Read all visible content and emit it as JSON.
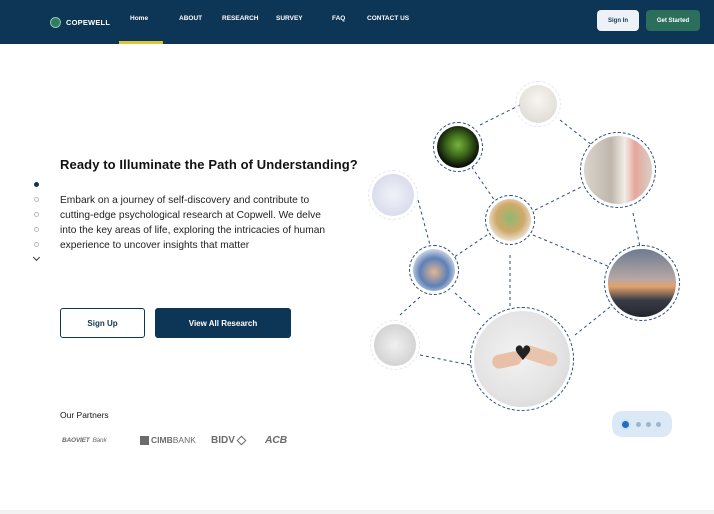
{
  "brand": {
    "name": "COPEWELL"
  },
  "nav": {
    "items": [
      "Home",
      "ABOUT",
      "RESEARCH",
      "SURVEY",
      "FAQ",
      "CONTACT US"
    ],
    "active": "Home",
    "sign_in": "Sign In",
    "get_started": "Get Started"
  },
  "colors": {
    "navy": "#0d3556",
    "green": "#2c6e5c",
    "accent_underline": "#d9c63a"
  },
  "hero": {
    "title": "Ready to Illuminate the Path of Understanding?",
    "description_lines": [
      "Embark on a journey of self-discovery and contribute to",
      "cutting-edge psychological research at Copwell. We delve",
      "into the key areas of life, exploring the intricacies of human",
      "experience to uncover insights that matter"
    ],
    "signup_label": "Sign Up",
    "view_research_label": "View All Research"
  },
  "slider": {
    "count": 5,
    "active_index": 0
  },
  "partners": {
    "label": "Our Partners",
    "logos": [
      {
        "main": "BAOVIET",
        "sub": "Bank"
      },
      {
        "main": "CIMB",
        "sub": "BANK"
      },
      {
        "main": "BIDV"
      },
      {
        "main": "ACB"
      }
    ]
  },
  "network_images": [
    "plant",
    "person-in-light",
    "office-meeting",
    "globe",
    "joined-hands",
    "person-arms-raised",
    "heart-exchange",
    "faded-person",
    "faded-desk"
  ],
  "chat": {
    "icon": "chat-bubble-icon"
  }
}
